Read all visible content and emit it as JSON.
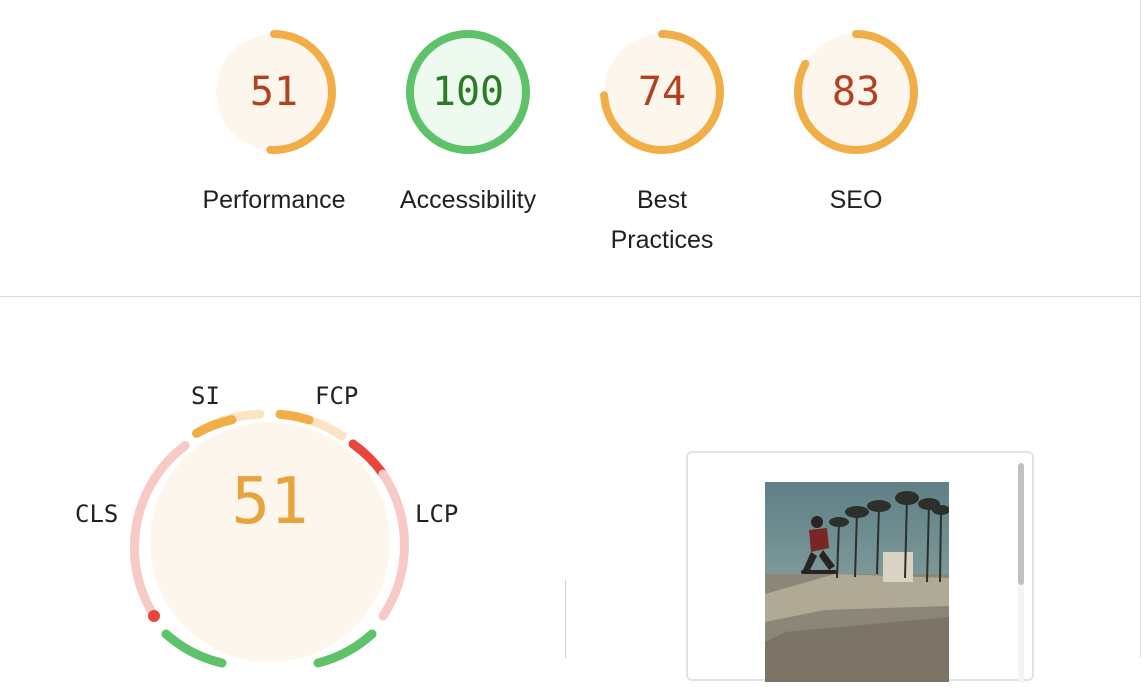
{
  "summary_gauges": [
    {
      "label": "Performance",
      "score": "51",
      "level": 0.51,
      "color": "#f1ad46",
      "fill": "#fdf6ec",
      "text_color": "#b3411f"
    },
    {
      "label": "Accessibility",
      "score": "100",
      "level": 1.0,
      "color": "#5dc26a",
      "fill": "#eefaf0",
      "text_color": "#2a7d24"
    },
    {
      "label": "Best\nPractices",
      "score": "74",
      "level": 0.74,
      "color": "#f1ad46",
      "fill": "#fdf6ec",
      "text_color": "#b3411f"
    },
    {
      "label": "SEO",
      "score": "83",
      "level": 0.83,
      "color": "#f1ad46",
      "fill": "#fdf6ec",
      "text_color": "#b3411f"
    }
  ],
  "performance_detail": {
    "score": "51",
    "metrics": {
      "si": "SI",
      "fcp": "FCP",
      "lcp": "LCP",
      "cls": "CLS"
    }
  },
  "colors": {
    "average": "#f1ad46",
    "pass": "#5dc26a",
    "fail": "#e8453c",
    "average_light": "#fbe3c4",
    "fail_light": "#f7cac6"
  },
  "icons": {
    "thumbnail": "skatepark-photo"
  }
}
